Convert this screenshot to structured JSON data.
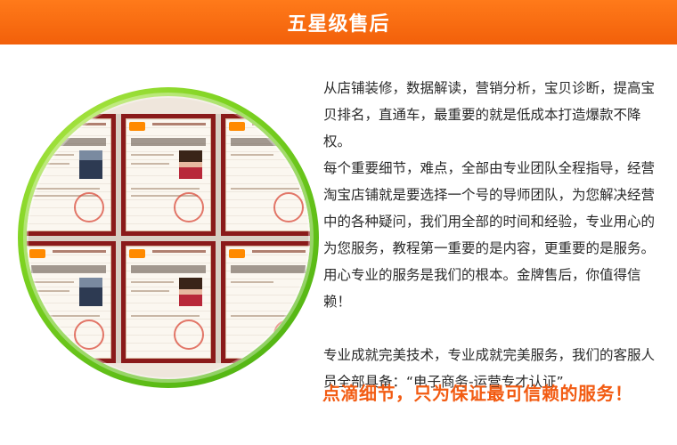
{
  "header": {
    "title": "五星级售后"
  },
  "content": {
    "paragraph1": "从店铺装修，数据解读，营销分析，宝贝诊断，提高宝贝排名，直通车，最重要的就是低成本打造爆款不降权。",
    "paragraph2": "每个重要细节，难点，全部由专业团队全程指导，经营淘宝店铺就是要选择一个号的导师团队，为您解决经营中的各种疑问，我们用全部的时间和经验，专业用心的为您服务，教程第一重要的是内容，更重要的是服务。用心专业的服务是我们的根本。金牌售后，你值得信赖！",
    "paragraph3": "专业成就完美技术，专业成就完美服务，我们的客服人员全部具备：“电子商务-运营专才认证”"
  },
  "slogan": "点滴细节，只为保证最可信赖的服务！",
  "colors": {
    "header_bg": "#f2600a",
    "slogan": "#f25b12",
    "ring": "#7ed321",
    "certificate_border": "#8a1a1a"
  },
  "image": {
    "certificates": [
      {
        "name": "certificate-1",
        "photo": "male"
      },
      {
        "name": "certificate-2",
        "photo": "female"
      },
      {
        "name": "certificate-3",
        "photo": "none"
      },
      {
        "name": "certificate-4",
        "photo": "male"
      },
      {
        "name": "certificate-5",
        "photo": "female"
      },
      {
        "name": "certificate-6",
        "photo": "none"
      }
    ]
  }
}
